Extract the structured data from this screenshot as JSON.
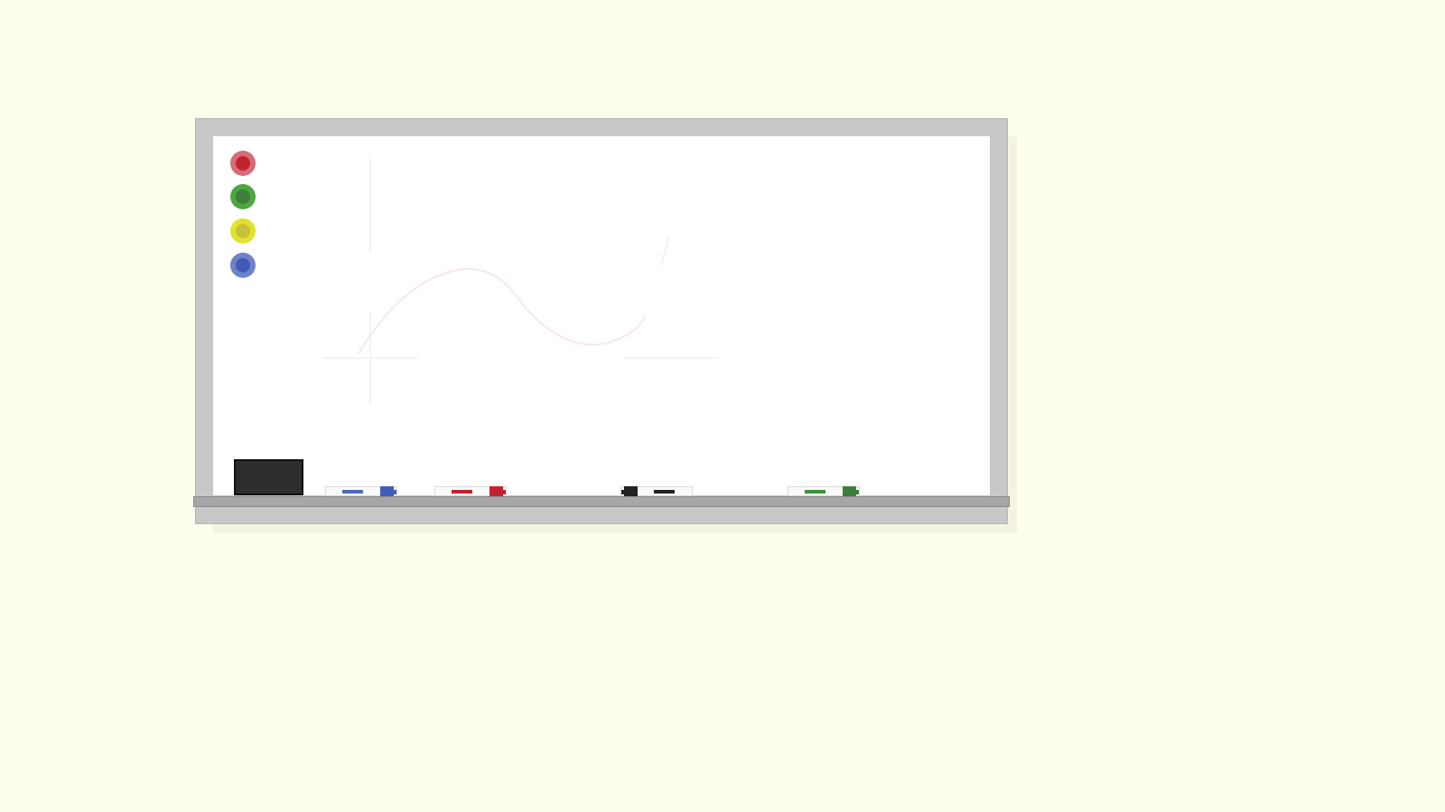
{
  "whiteboard": {
    "magnets": [
      {
        "color": "red",
        "accent": "#c0232e"
      },
      {
        "color": "green",
        "accent": "#3d7f3b"
      },
      {
        "color": "yellow",
        "accent": "#c5c23a"
      },
      {
        "color": "blue",
        "accent": "#3f5bb7"
      }
    ],
    "tray": {
      "eraser": {
        "color": "#2d2d2d"
      },
      "markers": [
        {
          "color": "blue",
          "accent": "#405db9"
        },
        {
          "color": "red",
          "accent": "#c0232e"
        },
        {
          "color": "black",
          "accent": "#222222"
        },
        {
          "color": "green",
          "accent": "#3f7f3e"
        }
      ]
    }
  }
}
